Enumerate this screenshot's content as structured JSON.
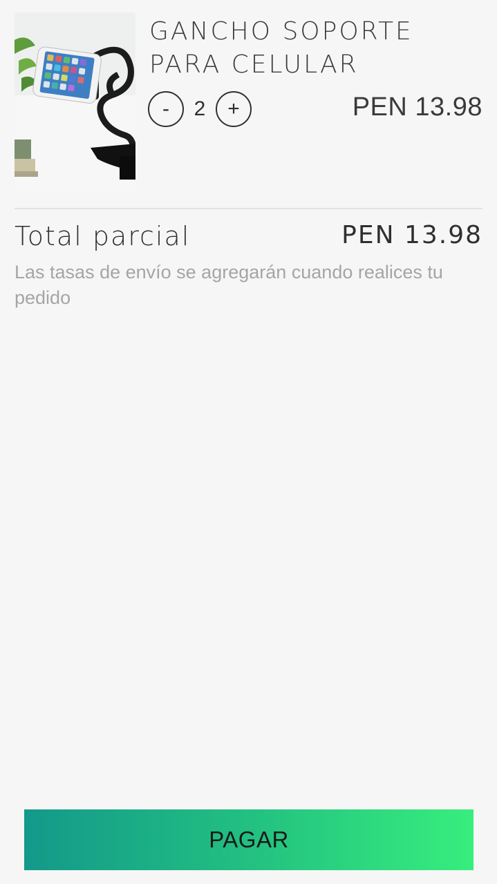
{
  "cart": {
    "items": [
      {
        "name": "GANCHO SOPORTE PARA CELULAR",
        "image_alt": "phone holder",
        "quantity": "2",
        "decrement_label": "-",
        "increment_label": "+",
        "price": "PEN 13.98"
      }
    ]
  },
  "summary": {
    "subtotal_label": "Total parcial",
    "subtotal_value": "PEN 13.98",
    "shipping_note": "Las tasas de envío se agregarán cuando realices tu pedido"
  },
  "checkout": {
    "pay_label": "PAGAR"
  },
  "colors": {
    "background": "#f6f6f6",
    "button_gradient_start": "#13998a",
    "button_gradient_end": "#37ee7d",
    "muted_text": "#a5a5a5"
  },
  "icons": {
    "product_image": "phone-holder-image"
  }
}
